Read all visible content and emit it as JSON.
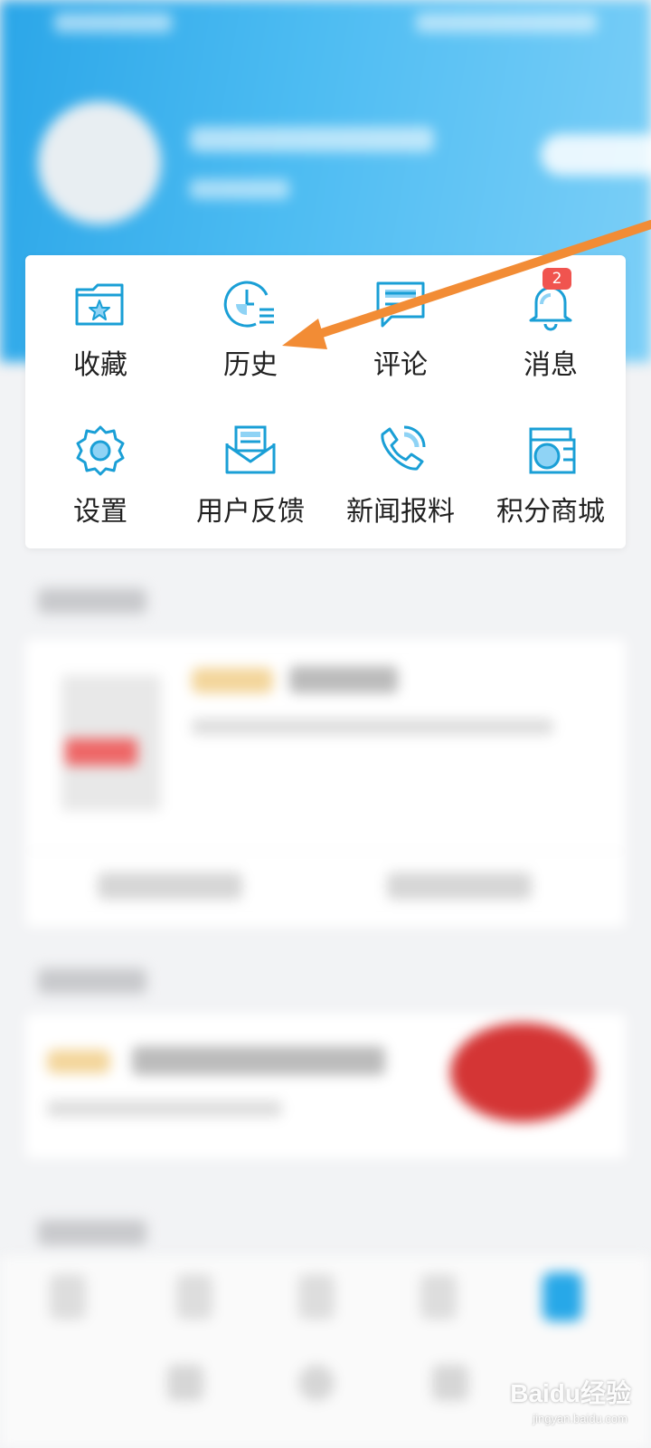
{
  "menu": {
    "row1": [
      {
        "label": "收藏",
        "icon": "favorites-folder-icon"
      },
      {
        "label": "历史",
        "icon": "history-clock-icon"
      },
      {
        "label": "评论",
        "icon": "comment-icon"
      },
      {
        "label": "消息",
        "icon": "bell-icon"
      }
    ],
    "row2": [
      {
        "label": "设置",
        "icon": "gear-icon"
      },
      {
        "label": "用户反馈",
        "icon": "feedback-envelope-icon"
      },
      {
        "label": "新闻报料",
        "icon": "phone-tip-icon"
      },
      {
        "label": "积分商城",
        "icon": "points-mall-icon"
      }
    ],
    "message_badge": "2"
  },
  "colors": {
    "header_start": "#2ba6e8",
    "header_end": "#7ccff7",
    "icon_stroke": "#1a9fd6",
    "icon_fill": "#8fd3f5",
    "badge": "#f0544f",
    "arrow": "#f28c35"
  },
  "watermark": {
    "brand": "Baidu经验",
    "url": "jingyan.baidu.com"
  }
}
